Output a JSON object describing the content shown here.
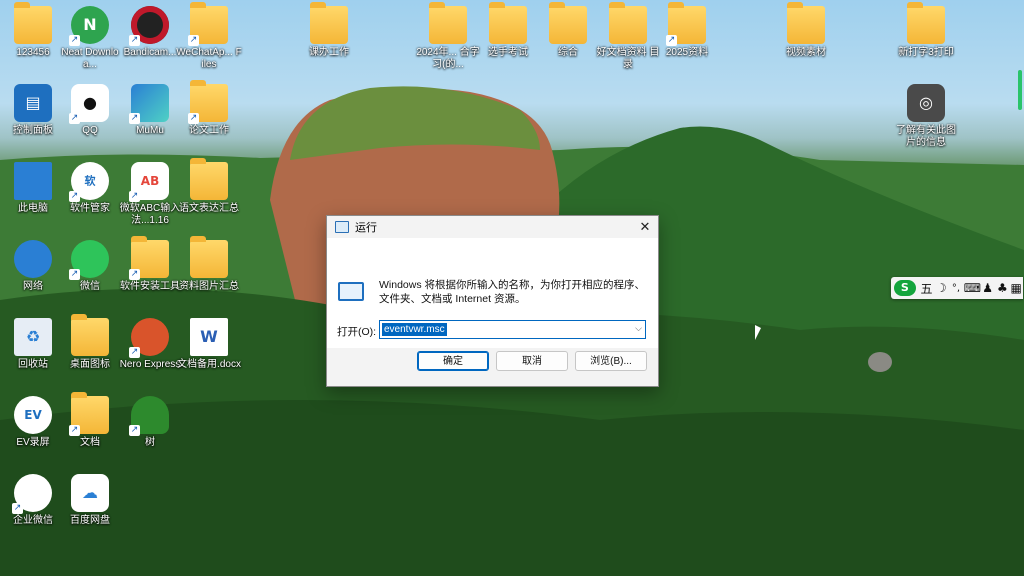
{
  "desktop": {
    "icons": [
      {
        "label": "123456",
        "icon": "user-folder-icon",
        "color": "#f4b637"
      },
      {
        "label": "Neat Downloa...",
        "icon": "n-app-icon",
        "color": "#2ea44f"
      },
      {
        "label": "Bandicam...",
        "icon": "record-icon",
        "color": "#c0192b"
      },
      {
        "label": "WeChatAp... Files",
        "icon": "folder-icon",
        "color": "#f4b637"
      },
      {
        "label": "课办工作",
        "icon": "folder-icon",
        "color": "#f4b637"
      },
      {
        "label": "2024年... 合字习(的...",
        "icon": "folder-icon",
        "color": "#f4b637"
      },
      {
        "label": "选手考试",
        "icon": "folder-icon",
        "color": "#f4b637"
      },
      {
        "label": "综合",
        "icon": "folder-icon",
        "color": "#f4b637"
      },
      {
        "label": "好文档资料 目录",
        "icon": "folder-icon",
        "color": "#f4b637"
      },
      {
        "label": "2025资料",
        "icon": "folder-icon",
        "color": "#f4b637"
      },
      {
        "label": "视频素材",
        "icon": "folder-icon",
        "color": "#f4b637"
      },
      {
        "label": "新打字3打印",
        "icon": "folder-icon",
        "color": "#f4b637"
      },
      {
        "label": "控制面板",
        "icon": "control-panel-icon",
        "color": "#1e6fbf"
      },
      {
        "label": "QQ",
        "icon": "qq-icon",
        "color": "#111111"
      },
      {
        "label": "MuMu",
        "icon": "mumu-icon",
        "color": "#2a7fd4"
      },
      {
        "label": "论文工作",
        "icon": "folder-icon",
        "color": "#f4b637"
      },
      {
        "label": "了解有关此图片的信息",
        "icon": "camera-icon",
        "color": "#555555"
      },
      {
        "label": "此电脑",
        "icon": "computer-icon",
        "color": "#2a7fd4"
      },
      {
        "label": "软件管家",
        "icon": "software-manager-icon",
        "color": "#1e6fbf"
      },
      {
        "label": "微软ABC输入法...1.16",
        "icon": "abc-icon",
        "color": "#e4463b"
      },
      {
        "label": "语文表达汇总",
        "icon": "folder-icon",
        "color": "#f4b637"
      },
      {
        "label": "网络",
        "icon": "network-icon",
        "color": "#2a7fd4"
      },
      {
        "label": "微信",
        "icon": "wechat-icon",
        "color": "#2ec45a"
      },
      {
        "label": "软件安装工具",
        "icon": "folder-icon",
        "color": "#f4b637"
      },
      {
        "label": "资料图片汇总",
        "icon": "folder-icon",
        "color": "#f4b637"
      },
      {
        "label": "回收站",
        "icon": "recycle-bin-icon",
        "color": "#cfd8e3"
      },
      {
        "label": "桌面图标",
        "icon": "folder-icon",
        "color": "#f4b637"
      },
      {
        "label": "Nero Express",
        "icon": "nero-icon",
        "color": "#d9542b"
      },
      {
        "label": "文档备用.docx",
        "icon": "word-icon",
        "color": "#2b5fb4"
      },
      {
        "label": "EV录屏",
        "icon": "ev-icon",
        "color": "#1e6fbf"
      },
      {
        "label": "文档",
        "icon": "folder-icon",
        "color": "#f4b637"
      },
      {
        "label": "树",
        "icon": "tree-icon",
        "color": "#2d8a2d"
      },
      {
        "label": "企业微信",
        "icon": "wecom-icon",
        "color": "#2a7fd4"
      },
      {
        "label": "百度网盘",
        "icon": "baidu-netdisk-icon",
        "color": "#2a7fd4"
      }
    ]
  },
  "run_dialog": {
    "title": "运行",
    "close_glyph": "✕",
    "description": "Windows 将根据你所输入的名称，为你打开相应的程序、文件夹、文档或 Internet 资源。",
    "open_label": "打开(O):",
    "input_value": "eventvwr.msc",
    "ok_label": "确定",
    "cancel_label": "取消",
    "browse_label": "浏览(B)..."
  },
  "ime_bar": {
    "logo": "S",
    "mode": "五",
    "moon": "☽",
    "punct": "°,",
    "keyboard": "⌨",
    "user": "♟",
    "shirt": "♣",
    "grid": "▦"
  }
}
